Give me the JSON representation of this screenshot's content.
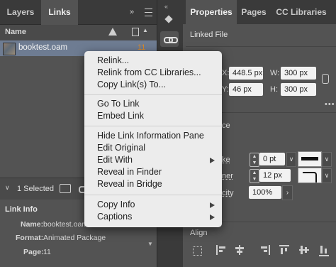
{
  "left_panel": {
    "tabs": [
      "Layers",
      "Links"
    ],
    "column_name": "Name",
    "link_row": {
      "name": "booktest.oam",
      "page": "11"
    },
    "selected_count": "1 Selected",
    "link_info": {
      "title": "Link Info",
      "name_label": "Name:",
      "name_value": "booktest.oam",
      "format_label": "Format:",
      "format_value": "Animated Package",
      "page_label": "Page:",
      "page_value": "11"
    }
  },
  "right_panel": {
    "tabs": [
      "Properties",
      "Pages",
      "CC Libraries"
    ],
    "section_linked_file": "Linked File",
    "x_label": "X:",
    "x_value": "448.5 px",
    "y_label": "Y:",
    "y_value": "46 px",
    "w_label": "W:",
    "w_value": "300 px",
    "h_label": "H:",
    "h_value": "300 px",
    "appearance_partial": "ce",
    "stroke_partial": "ke",
    "stroke_weight": "0 pt",
    "corner_partial": "ner",
    "corner_value": "12 px",
    "opacity_partial": "city",
    "opacity_value": "100%",
    "align_title": "Align"
  },
  "context_menu": {
    "groups": [
      [
        "Relink...",
        "Relink from CC Libraries...",
        "Copy Link(s) To..."
      ],
      [
        "Go To Link",
        "Embed Link"
      ],
      [
        "Hide Link Information Pane",
        "Edit Original",
        "Edit With",
        "Reveal in Finder",
        "Reveal in Bridge"
      ],
      [
        "Copy Info",
        "Captions"
      ]
    ],
    "submenu_items": [
      "Edit With",
      "Copy Info",
      "Captions"
    ]
  },
  "colors": {
    "panel": "#535353",
    "selection": "#6e7c92",
    "menu": "#ececec",
    "link_page": "#d98a2b"
  }
}
